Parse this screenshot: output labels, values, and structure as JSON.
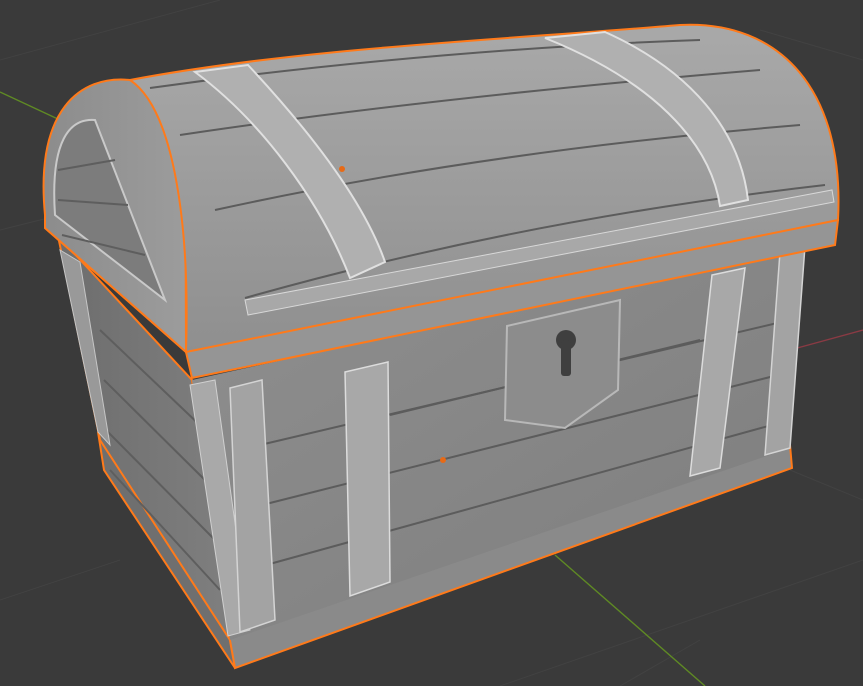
{
  "app": "3D viewport",
  "scene": {
    "object": "treasure-chest",
    "object_state": "selected",
    "shading_mode": "solid"
  },
  "colors": {
    "background": "#3a3a3a",
    "grid_line": "#444444",
    "x_axis": "#8a3a44",
    "y_axis": "#5f8a24",
    "selection_outline": "#ff7a1a",
    "object_origin": "#e86a16",
    "body_light": "#a4a4a4",
    "body_mid": "#8e8e8e",
    "body_dark": "#6e6e6e",
    "band": "#b2b2b2",
    "plank_line": "#5a5a5a"
  },
  "icons": {
    "lock": "keyhole-plate-icon"
  }
}
